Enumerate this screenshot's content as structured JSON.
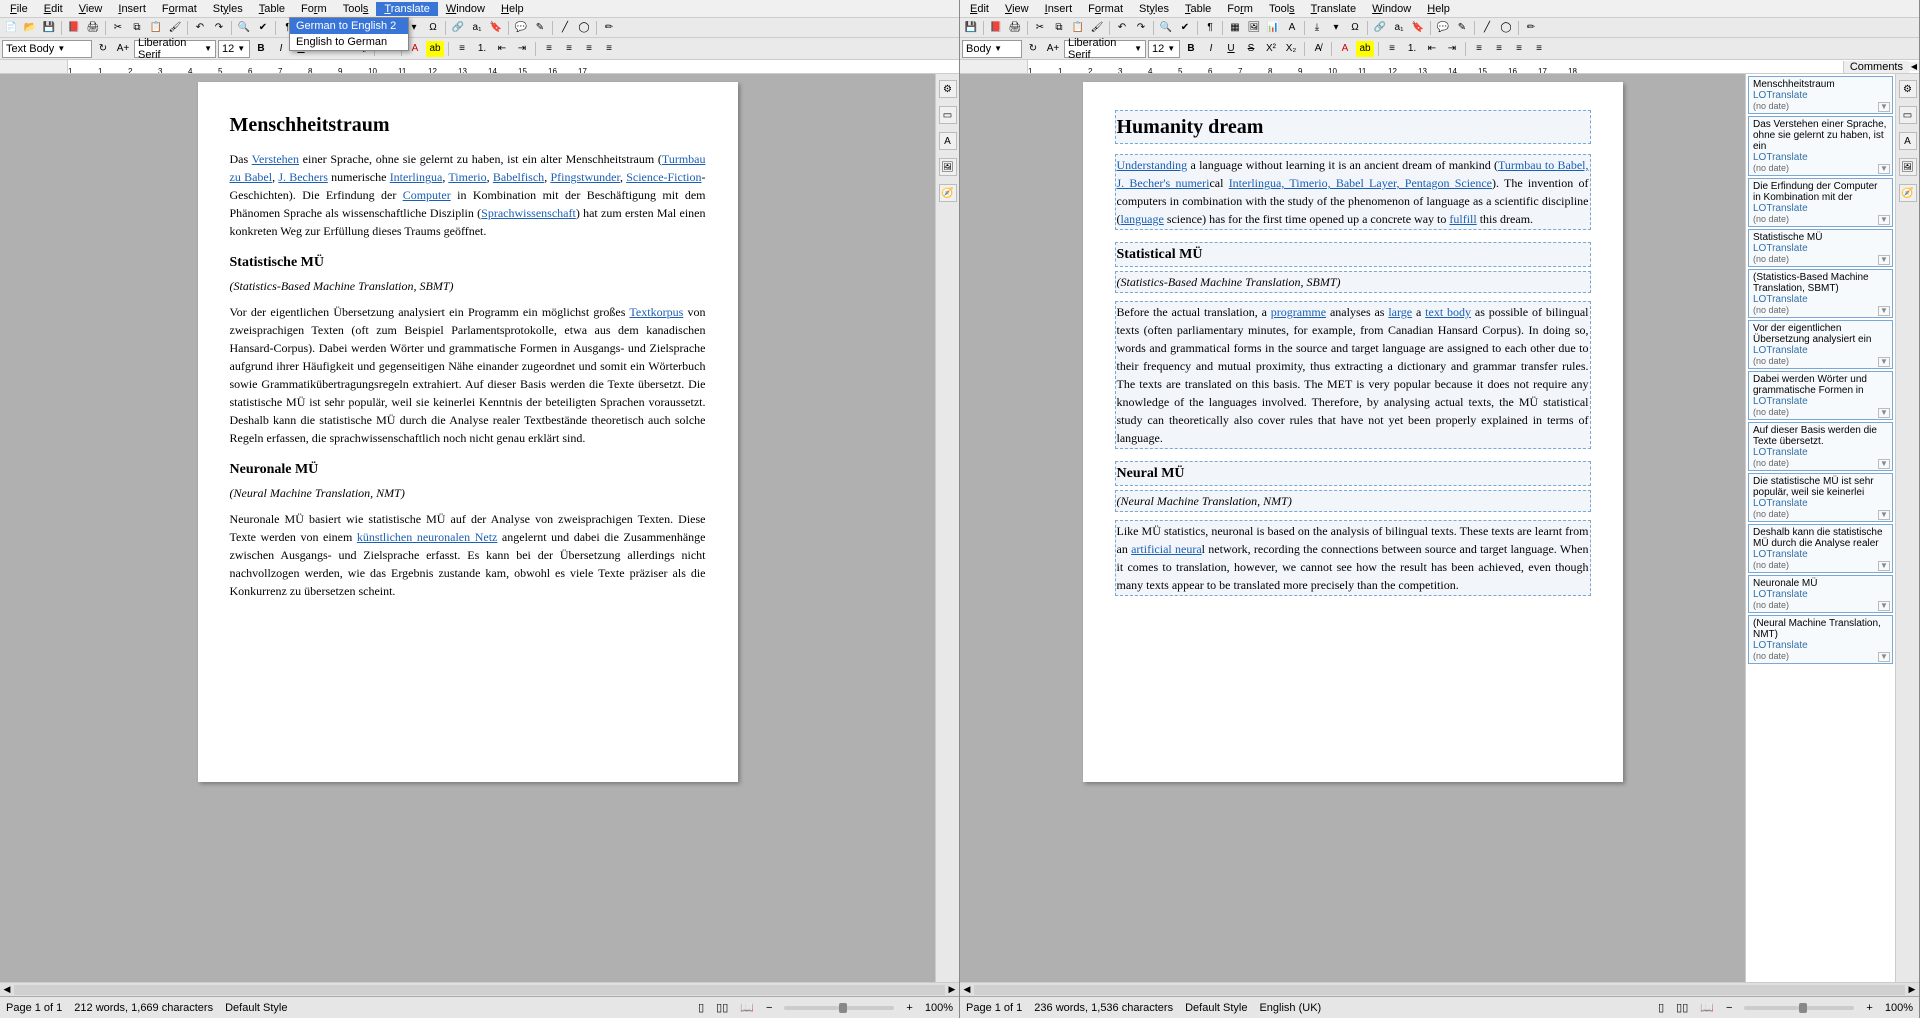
{
  "menus": {
    "file": "File",
    "edit": "Edit",
    "view": "View",
    "insert": "Insert",
    "format": "Format",
    "styles": "Styles",
    "table": "Table",
    "form": "Form",
    "tools": "Tools",
    "translate": "Translate",
    "window": "Window",
    "help": "Help"
  },
  "translate_menu": {
    "ge2en": "German to English 2",
    "en2ge": "English to German"
  },
  "format_bar": {
    "style": "Text Body",
    "style_right": "Body",
    "font": "Liberation Serif",
    "size": "12"
  },
  "ruler_marks": [
    "1",
    "1",
    "2",
    "3",
    "4",
    "5",
    "6",
    "7",
    "8",
    "9",
    "10",
    "11",
    "12",
    "13",
    "14",
    "15",
    "16",
    "17",
    "18"
  ],
  "left_doc": {
    "h1": "Menschheitstraum",
    "p1_a": "Das ",
    "p1_link1": "Verstehen",
    "p1_b": " einer Sprache, ohne sie gelernt zu haben, ist ein alter Menschheitstraum (",
    "p1_link2": "Turmbau zu Babel",
    "p1_c": ", ",
    "p1_link3": "J. Bechers",
    "p1_d": " numerische ",
    "p1_link4": "Interlingua",
    "p1_e": ", ",
    "p1_link5": "Timerio",
    "p1_f": ", ",
    "p1_link6": "Babelfisch",
    "p1_g": ", ",
    "p1_link7": "Pfingstwunder",
    "p1_h": ", ",
    "p1_link8": "Science-Fiction",
    "p1_i": "-Geschichten). Die Erfindung der ",
    "p1_link9": "Computer",
    "p1_j": " in Kombination mit der Beschäftigung mit dem Phänomen Sprache als wissenschaftliche Disziplin (",
    "p1_link10": "Sprachwissenschaft",
    "p1_k": ") hat zum ersten Mal einen konkreten Weg zur Erfüllung dieses Traums geöffnet.",
    "h2a": "Statistische MÜ",
    "p2": "(Statistics-Based Machine Translation, SBMT)",
    "p3_a": "Vor der eigentlichen Übersetzung analysiert ein Programm ein möglichst großes ",
    "p3_link1": "Textkorpus",
    "p3_b": " von zweisprachigen Texten (oft zum Beispiel Parlamentsprotokolle, etwa aus dem kanadischen Hansard-Corpus). Dabei werden Wörter und grammatische Formen in Ausgangs- und Zielsprache aufgrund ihrer Häufigkeit und gegenseitigen Nähe einander zugeordnet und somit ein Wörterbuch sowie Grammatikübertragungsregeln extrahiert. Auf dieser Basis werden die Texte übersetzt. Die statistische MÜ ist sehr populär, weil sie keinerlei Kenntnis der beteiligten Sprachen voraussetzt. Deshalb kann die statistische MÜ durch die Analyse realer Textbestände theoretisch auch solche Regeln erfassen, die sprachwissenschaftlich noch nicht genau erklärt sind.",
    "h2b": "Neuronale MÜ",
    "p4": "(Neural Machine Translation, NMT)",
    "p5_a": "Neuronale MÜ basiert wie statistische MÜ auf der Analyse von zweisprachigen Texten. Diese Texte werden von einem ",
    "p5_link1": "künstlichen neuronalen Netz",
    "p5_b": " angelernt und dabei die Zusammenhänge zwischen Ausgangs- und Zielsprache erfasst. Es kann bei der Übersetzung allerdings nicht nachvollzogen werden, wie das Ergebnis zustande kam, obwohl es viele Texte präziser als die Konkurrenz zu übersetzen scheint."
  },
  "right_doc": {
    "h1": "Humanity dream",
    "p1_link1": "Understanding",
    "p1_a": " a language without learning it is an ancient dream of mankind (",
    "p1_link2": "Turmbau to Babel, J. Becher's numeri",
    "p1_b": "cal ",
    "p1_link3": "Interlingua, Timerio, Babel Layer, Pentagon Science",
    "p1_c": "). The invention of computers in combination with the study of the phenomenon of language as a scientific discipline (",
    "p1_link4": "language",
    "p1_d": " science) has for the first time opened up a concrete way to ",
    "p1_link5": "fulfill",
    "p1_e": " this dream.",
    "h2a": "Statistical MÜ",
    "p2": "(Statistics-Based Machine Translation, SBMT)",
    "p3_a": "Before the actual translation, a ",
    "p3_link1": "programme",
    "p3_b": " analyses as ",
    "p3_link2": "large",
    "p3_c": " a ",
    "p3_link3": "text body",
    "p3_d": " as possible of bilingual texts (often parliamentary minutes, for example, from Canadian Hansard Corpus). In doing so, words and grammatical forms in the source and target language are assigned to each other due to their frequency and mutual proximity, thus extracting a dictionary and grammar transfer rules. The texts are translated on this basis. The MET is very popular because it does not require any knowledge of the languages involved. Therefore, by analysing actual texts, the MÜ statistical study can theoretically also cover rules that have not yet been properly explained in terms of language.",
    "h2b": "Neural MÜ",
    "p4": "(Neural Machine Translation, NMT)",
    "p5_a": "Like MÜ statistics, neuronal is based on the analysis of bilingual texts. These texts are learnt from an ",
    "p5_link1": "artificial neura",
    "p5_b": "l network, recording the connections between source and target language. When it comes to translation, however, we cannot see how the result has been achieved, even though many texts appear to be translated more precisely than the competition."
  },
  "comments_header": "Comments",
  "comments": [
    {
      "title": "Menschheitstraum",
      "auth": "LOTranslate",
      "date": "(no date)"
    },
    {
      "title": "Das Verstehen einer Sprache, ohne sie gelernt zu haben, ist ein",
      "auth": "LOTranslate",
      "date": "(no date)"
    },
    {
      "title": "Die Erfindung der Computer in Kombination mit der",
      "auth": "LOTranslate",
      "date": "(no date)"
    },
    {
      "title": "Statistische MÜ",
      "auth": "LOTranslate",
      "date": "(no date)"
    },
    {
      "title": "(Statistics-Based Machine Translation, SBMT)",
      "auth": "LOTranslate",
      "date": "(no date)"
    },
    {
      "title": "Vor der eigentlichen Übersetzung analysiert ein",
      "auth": "LOTranslate",
      "date": "(no date)"
    },
    {
      "title": "Dabei werden Wörter und grammatische Formen in",
      "auth": "LOTranslate",
      "date": "(no date)"
    },
    {
      "title": "Auf dieser Basis werden die Texte übersetzt.",
      "auth": "LOTranslate",
      "date": "(no date)"
    },
    {
      "title": "Die statistische MÜ ist sehr populär, weil sie keinerlei",
      "auth": "LOTranslate",
      "date": "(no date)"
    },
    {
      "title": "Deshalb kann die statistische MÜ durch die Analyse realer",
      "auth": "LOTranslate",
      "date": "(no date)"
    },
    {
      "title": "Neuronale MÜ",
      "auth": "LOTranslate",
      "date": "(no date)"
    },
    {
      "title": "(Neural Machine Translation, NMT)",
      "auth": "LOTranslate",
      "date": "(no date)"
    }
  ],
  "status_left": {
    "page": "Page 1 of 1",
    "words": "212 words, 1,669 characters",
    "style": "Default Style",
    "zoom": "100%"
  },
  "status_right": {
    "page": "Page 1 of 1",
    "words": "236 words, 1,536 characters",
    "style": "Default Style",
    "lang": "English (UK)",
    "zoom": "100%"
  }
}
